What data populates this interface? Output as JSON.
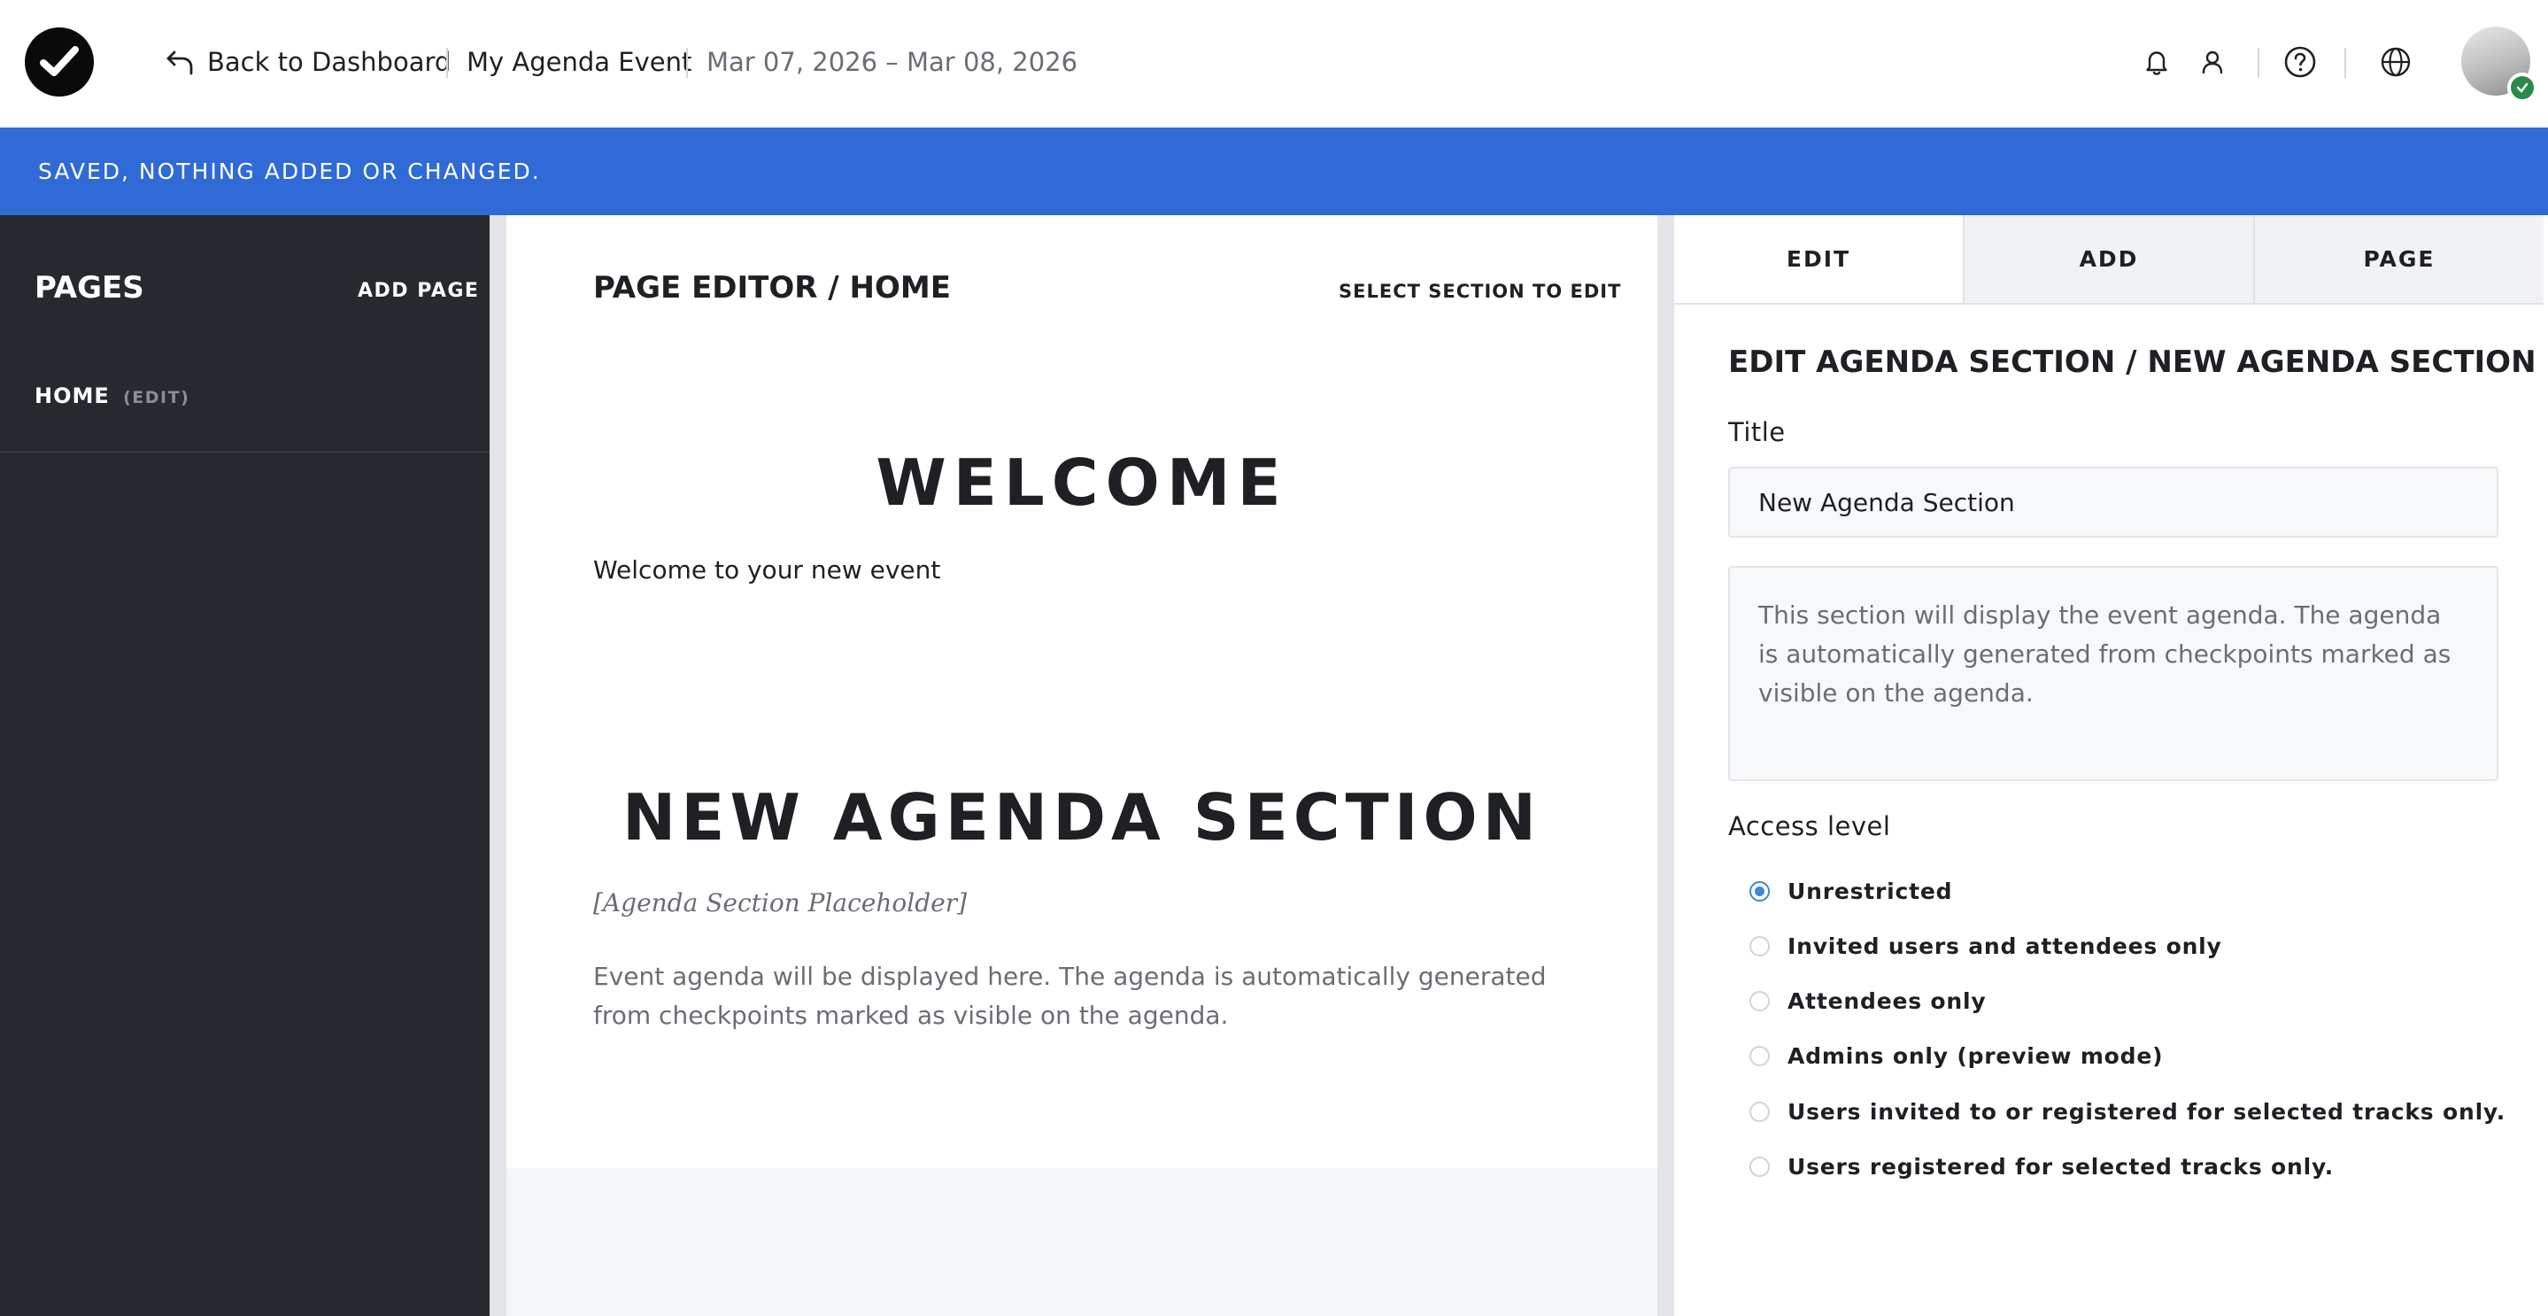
{
  "header": {
    "back_label": "Back to Dashboard",
    "event_name": "My Agenda Event",
    "event_dates": "Mar 07, 2026 – Mar 08, 2026"
  },
  "banner": {
    "message": "SAVED, NOTHING ADDED OR CHANGED."
  },
  "sidebar": {
    "title": "PAGES",
    "add_page_label": "ADD PAGE",
    "items": [
      {
        "label": "HOME",
        "edit_label": "(EDIT)"
      }
    ]
  },
  "editor": {
    "title": "PAGE EDITOR / HOME",
    "select_hint": "SELECT SECTION TO EDIT",
    "sections": [
      {
        "heading": "WELCOME",
        "body": "Welcome to your new event"
      },
      {
        "heading": "NEW AGENDA SECTION",
        "placeholder": "[Agenda Section Placeholder]",
        "body": "Event agenda will be displayed here. The agenda is automatically generated from checkpoints marked as visible on the agenda."
      }
    ]
  },
  "panel": {
    "tabs": [
      {
        "label": "EDIT",
        "active": true
      },
      {
        "label": "ADD",
        "active": false
      },
      {
        "label": "PAGE",
        "active": false
      }
    ],
    "title": "EDIT AGENDA SECTION / NEW AGENDA SECTION",
    "title_field_label": "Title",
    "title_field_value": "New Agenda Section",
    "info_text": "This section will display the event agenda. The agenda is automatically generated from checkpoints marked as visible on the agenda.",
    "access_label": "Access level",
    "access_options": [
      {
        "label": "Unrestricted",
        "checked": true
      },
      {
        "label": "Invited users and attendees only",
        "checked": false
      },
      {
        "label": "Attendees only",
        "checked": false
      },
      {
        "label": "Admins only (preview mode)",
        "checked": false
      },
      {
        "label": "Users invited to or registered for selected tracks only.",
        "checked": false
      },
      {
        "label": "Users registered for selected tracks only.",
        "checked": false
      }
    ]
  },
  "colors": {
    "banner": "#2f6ad6",
    "sidebar": "#26292e",
    "radio_accent": "#3f86d8"
  }
}
